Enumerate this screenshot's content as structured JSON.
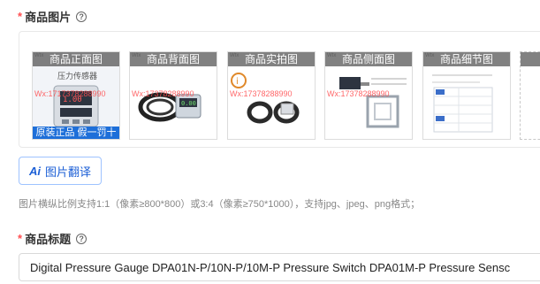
{
  "product_images": {
    "required_mark": "*",
    "label": "商品图片",
    "thumbnails": [
      {
        "caption": "商品正面图",
        "watermark": "Wx:1717378288990",
        "bottom_band": "原装正品 假一罚十"
      },
      {
        "caption": "商品背面图",
        "watermark": "Wx:17378288990"
      },
      {
        "caption": "商品实拍图",
        "watermark": "Wx:17378288990"
      },
      {
        "caption": "商品侧面图",
        "watermark": "Wx:17378288990"
      },
      {
        "caption": "商品细节图",
        "watermark": ""
      }
    ]
  },
  "translate_button": {
    "ai_label": "Ai",
    "label": "图片翻译"
  },
  "hint": "图片横纵比例支持1:1（像素≥800*800）或3:4（像素≥750*1000），支持jpg、jpeg、png格式；",
  "product_title": {
    "required_mark": "*",
    "label": "商品标题",
    "value": "Digital Pressure Gauge DPA01N-P/10N-P/10M-P Pressure Switch DPA01M-P Pressure Sensc"
  },
  "colors": {
    "required": "#ff4d4f",
    "accent": "#1c5fd6"
  }
}
